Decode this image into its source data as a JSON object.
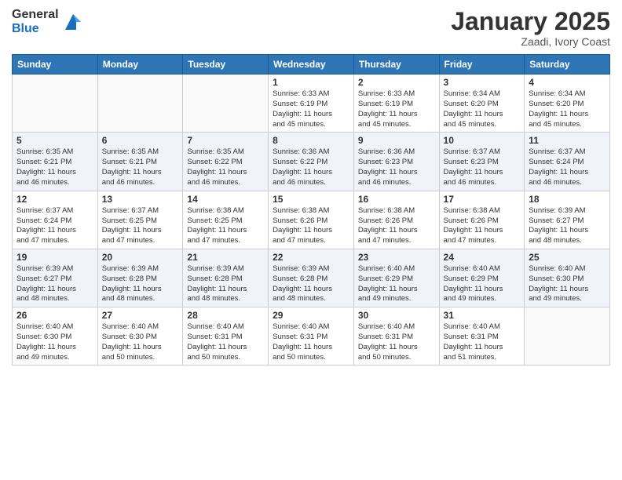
{
  "logo": {
    "general": "General",
    "blue": "Blue"
  },
  "title": "January 2025",
  "location": "Zaadi, Ivory Coast",
  "days_header": [
    "Sunday",
    "Monday",
    "Tuesday",
    "Wednesday",
    "Thursday",
    "Friday",
    "Saturday"
  ],
  "weeks": [
    [
      {
        "day": "",
        "info": ""
      },
      {
        "day": "",
        "info": ""
      },
      {
        "day": "",
        "info": ""
      },
      {
        "day": "1",
        "info": "Sunrise: 6:33 AM\nSunset: 6:19 PM\nDaylight: 11 hours\nand 45 minutes."
      },
      {
        "day": "2",
        "info": "Sunrise: 6:33 AM\nSunset: 6:19 PM\nDaylight: 11 hours\nand 45 minutes."
      },
      {
        "day": "3",
        "info": "Sunrise: 6:34 AM\nSunset: 6:20 PM\nDaylight: 11 hours\nand 45 minutes."
      },
      {
        "day": "4",
        "info": "Sunrise: 6:34 AM\nSunset: 6:20 PM\nDaylight: 11 hours\nand 45 minutes."
      }
    ],
    [
      {
        "day": "5",
        "info": "Sunrise: 6:35 AM\nSunset: 6:21 PM\nDaylight: 11 hours\nand 46 minutes."
      },
      {
        "day": "6",
        "info": "Sunrise: 6:35 AM\nSunset: 6:21 PM\nDaylight: 11 hours\nand 46 minutes."
      },
      {
        "day": "7",
        "info": "Sunrise: 6:35 AM\nSunset: 6:22 PM\nDaylight: 11 hours\nand 46 minutes."
      },
      {
        "day": "8",
        "info": "Sunrise: 6:36 AM\nSunset: 6:22 PM\nDaylight: 11 hours\nand 46 minutes."
      },
      {
        "day": "9",
        "info": "Sunrise: 6:36 AM\nSunset: 6:23 PM\nDaylight: 11 hours\nand 46 minutes."
      },
      {
        "day": "10",
        "info": "Sunrise: 6:37 AM\nSunset: 6:23 PM\nDaylight: 11 hours\nand 46 minutes."
      },
      {
        "day": "11",
        "info": "Sunrise: 6:37 AM\nSunset: 6:24 PM\nDaylight: 11 hours\nand 46 minutes."
      }
    ],
    [
      {
        "day": "12",
        "info": "Sunrise: 6:37 AM\nSunset: 6:24 PM\nDaylight: 11 hours\nand 47 minutes."
      },
      {
        "day": "13",
        "info": "Sunrise: 6:37 AM\nSunset: 6:25 PM\nDaylight: 11 hours\nand 47 minutes."
      },
      {
        "day": "14",
        "info": "Sunrise: 6:38 AM\nSunset: 6:25 PM\nDaylight: 11 hours\nand 47 minutes."
      },
      {
        "day": "15",
        "info": "Sunrise: 6:38 AM\nSunset: 6:26 PM\nDaylight: 11 hours\nand 47 minutes."
      },
      {
        "day": "16",
        "info": "Sunrise: 6:38 AM\nSunset: 6:26 PM\nDaylight: 11 hours\nand 47 minutes."
      },
      {
        "day": "17",
        "info": "Sunrise: 6:38 AM\nSunset: 6:26 PM\nDaylight: 11 hours\nand 47 minutes."
      },
      {
        "day": "18",
        "info": "Sunrise: 6:39 AM\nSunset: 6:27 PM\nDaylight: 11 hours\nand 48 minutes."
      }
    ],
    [
      {
        "day": "19",
        "info": "Sunrise: 6:39 AM\nSunset: 6:27 PM\nDaylight: 11 hours\nand 48 minutes."
      },
      {
        "day": "20",
        "info": "Sunrise: 6:39 AM\nSunset: 6:28 PM\nDaylight: 11 hours\nand 48 minutes."
      },
      {
        "day": "21",
        "info": "Sunrise: 6:39 AM\nSunset: 6:28 PM\nDaylight: 11 hours\nand 48 minutes."
      },
      {
        "day": "22",
        "info": "Sunrise: 6:39 AM\nSunset: 6:28 PM\nDaylight: 11 hours\nand 48 minutes."
      },
      {
        "day": "23",
        "info": "Sunrise: 6:40 AM\nSunset: 6:29 PM\nDaylight: 11 hours\nand 49 minutes."
      },
      {
        "day": "24",
        "info": "Sunrise: 6:40 AM\nSunset: 6:29 PM\nDaylight: 11 hours\nand 49 minutes."
      },
      {
        "day": "25",
        "info": "Sunrise: 6:40 AM\nSunset: 6:30 PM\nDaylight: 11 hours\nand 49 minutes."
      }
    ],
    [
      {
        "day": "26",
        "info": "Sunrise: 6:40 AM\nSunset: 6:30 PM\nDaylight: 11 hours\nand 49 minutes."
      },
      {
        "day": "27",
        "info": "Sunrise: 6:40 AM\nSunset: 6:30 PM\nDaylight: 11 hours\nand 50 minutes."
      },
      {
        "day": "28",
        "info": "Sunrise: 6:40 AM\nSunset: 6:31 PM\nDaylight: 11 hours\nand 50 minutes."
      },
      {
        "day": "29",
        "info": "Sunrise: 6:40 AM\nSunset: 6:31 PM\nDaylight: 11 hours\nand 50 minutes."
      },
      {
        "day": "30",
        "info": "Sunrise: 6:40 AM\nSunset: 6:31 PM\nDaylight: 11 hours\nand 50 minutes."
      },
      {
        "day": "31",
        "info": "Sunrise: 6:40 AM\nSunset: 6:31 PM\nDaylight: 11 hours\nand 51 minutes."
      },
      {
        "day": "",
        "info": ""
      }
    ]
  ]
}
